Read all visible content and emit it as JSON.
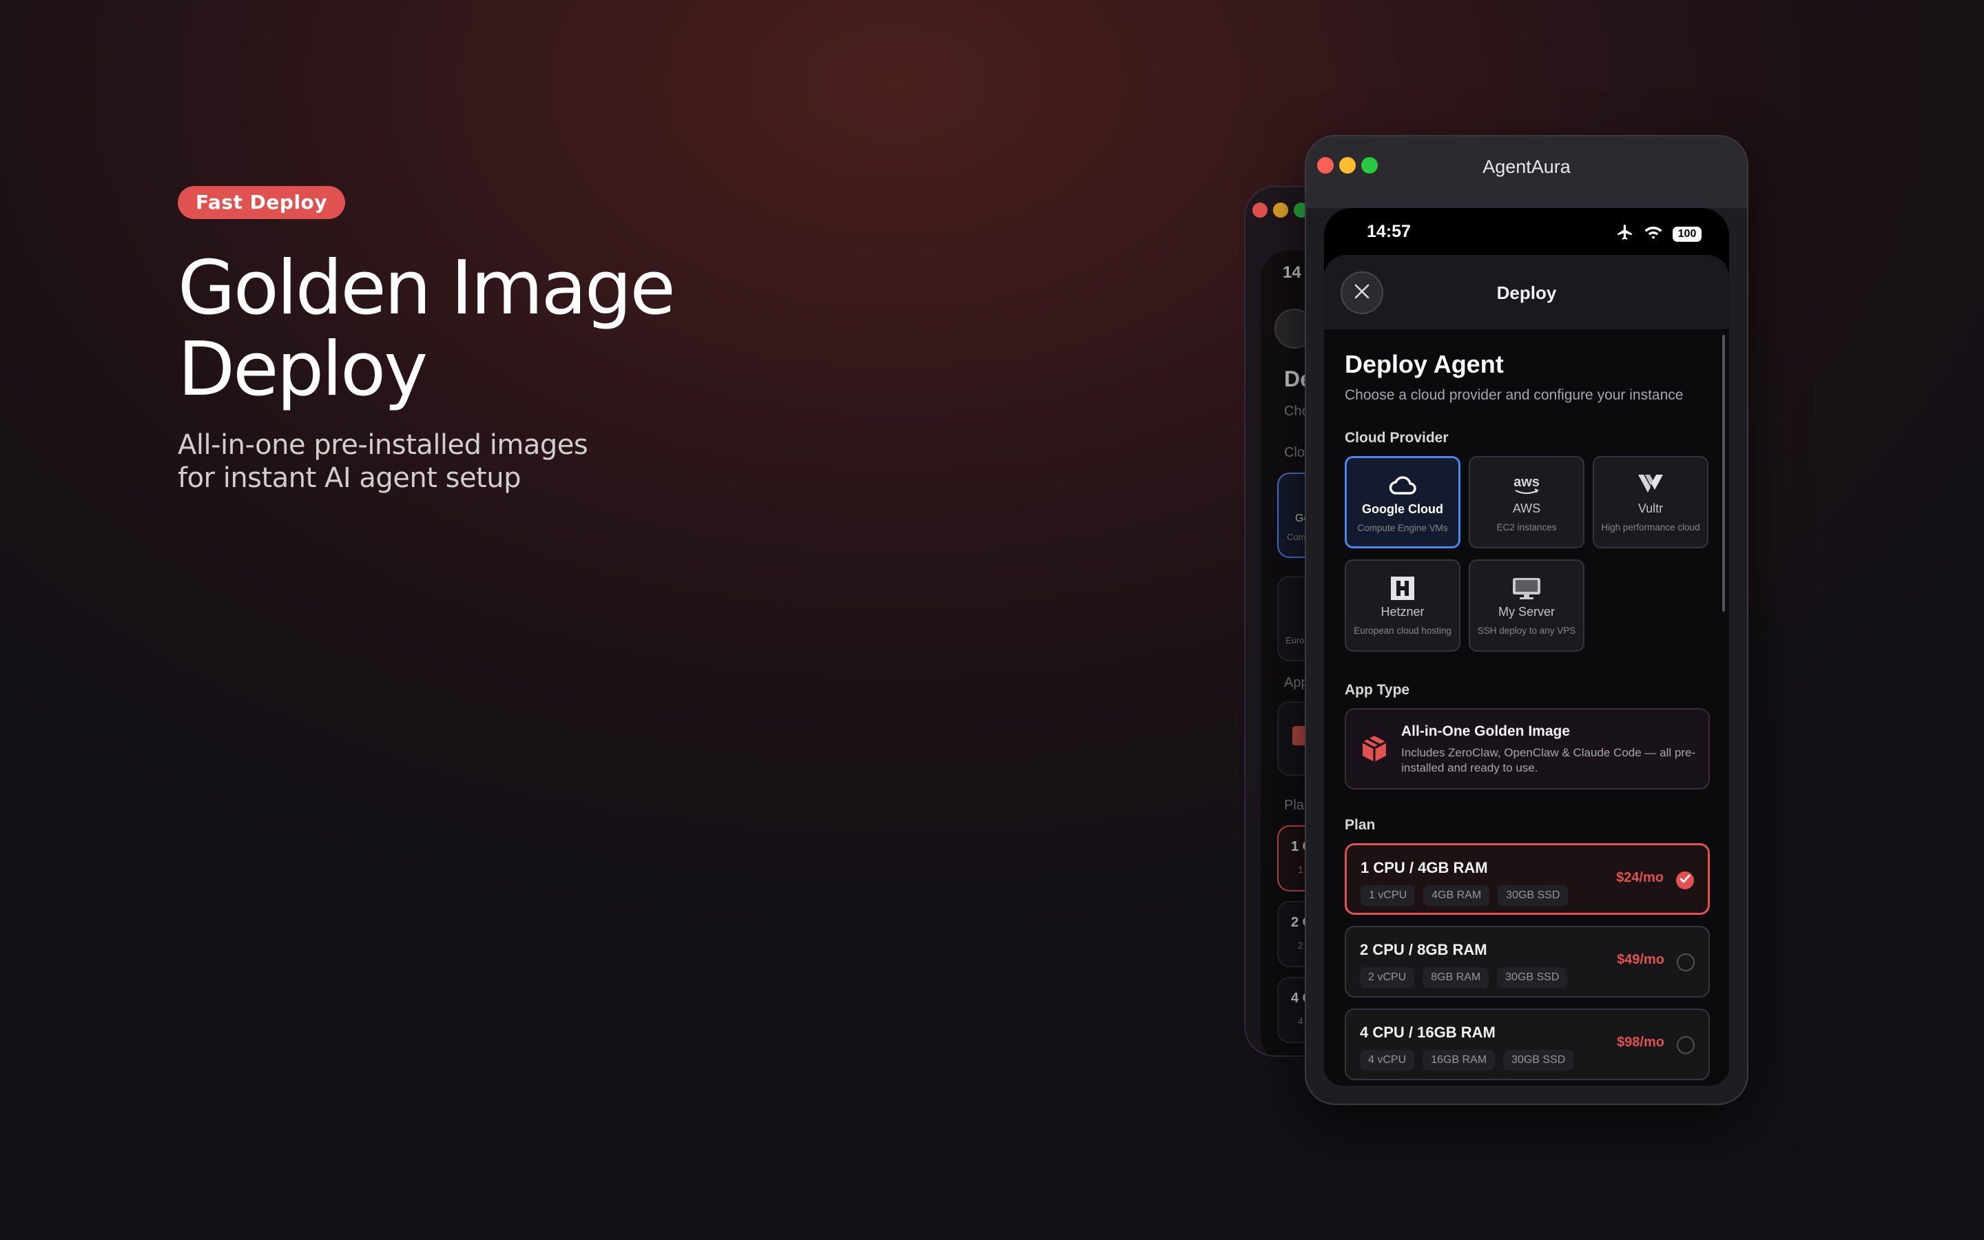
{
  "hero": {
    "badge": "Fast Deploy",
    "title_line1": "Golden Image",
    "title_line2": "Deploy",
    "subtitle_line1": "All-in-one pre-installed images",
    "subtitle_line2": "for instant AI agent setup"
  },
  "window": {
    "title": "AgentAura"
  },
  "status_bar": {
    "time": "14:57",
    "icons": [
      "airplane-icon",
      "wifi-icon"
    ],
    "battery": "100"
  },
  "sheet": {
    "title": "Deploy",
    "heading": "Deploy Agent",
    "subtitle": "Choose a cloud provider and configure your instance"
  },
  "cloud_provider": {
    "label": "Cloud Provider",
    "selected": "Google Cloud",
    "accent_color": "#4c86ee",
    "providers": [
      {
        "name": "Google Cloud",
        "description": "Compute Engine VMs",
        "icon": "cloud-icon"
      },
      {
        "name": "AWS",
        "description": "EC2 instances",
        "icon": "aws-logo-icon",
        "logo_text": "aws"
      },
      {
        "name": "Vultr",
        "description": "High performance cloud",
        "icon": "vultr-logo-icon"
      },
      {
        "name": "Hetzner",
        "description": "European cloud hosting",
        "icon": "hetzner-logo-icon"
      },
      {
        "name": "My Server",
        "description": "SSH deploy to any VPS",
        "icon": "monitor-icon"
      }
    ]
  },
  "app_type": {
    "label": "App Type",
    "title": "All-in-One Golden Image",
    "description": "Includes ZeroClaw, OpenClaw & Claude Code — all pre-installed and ready to use.",
    "icon": "package-icon"
  },
  "plan": {
    "label": "Plan",
    "accent_color": "#e0524f",
    "selected": "1 CPU / 4GB RAM",
    "options": [
      {
        "name": "1 CPU / 4GB RAM",
        "specs": [
          "1 vCPU",
          "4GB RAM",
          "30GB SSD"
        ],
        "price": "$24/mo"
      },
      {
        "name": "2 CPU / 8GB RAM",
        "specs": [
          "2 vCPU",
          "8GB RAM",
          "30GB SSD"
        ],
        "price": "$49/mo"
      },
      {
        "name": "4 CPU / 16GB RAM",
        "specs": [
          "4 vCPU",
          "16GB RAM",
          "30GB SSD"
        ],
        "price": "$98/mo"
      }
    ]
  },
  "back_window": {
    "time": "14",
    "heading": "Dep",
    "subtitle": "Choc",
    "cloud_label": "Clou",
    "provider_name": "Go",
    "provider_desc": "Comp",
    "provider2_desc": "Europ",
    "app_label": "App",
    "plan_label": "Plan",
    "plan1_name": "1 C",
    "plan1_spec": "1",
    "plan2_name": "2 C",
    "plan2_spec": "2",
    "plan3_name": "4 C",
    "plan3_spec": "4"
  }
}
